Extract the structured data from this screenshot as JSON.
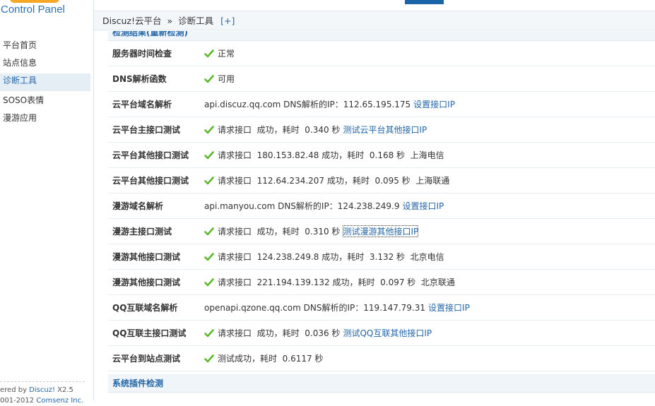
{
  "brand": {
    "name": "Control Panel",
    "accent": "#2a72b5",
    "orange": "#f39800"
  },
  "sidebar": {
    "items": [
      {
        "label": "平台首页",
        "active": false
      },
      {
        "label": "站点信息",
        "active": false
      },
      {
        "label": "诊断工具",
        "active": true
      },
      {
        "label": "SOSO表情",
        "active": false
      },
      {
        "label": "漫游应用",
        "active": false
      }
    ],
    "footer": {
      "line1_prefix": "ered by ",
      "line1_link": "Discuz!",
      "line1_suffix": " X2.5",
      "line2_prefix": "001-2012 ",
      "line2_link": "Comsenz Inc."
    }
  },
  "breadcrumb": {
    "root": "Discuz!云平台",
    "sep": "»",
    "current": "诊断工具",
    "add": "[+]"
  },
  "section_top": "检测结果(重新检测)",
  "rows": [
    {
      "label": "服务器时间检查",
      "ok": true,
      "text": "正常",
      "link": ""
    },
    {
      "label": "DNS解析函数",
      "ok": true,
      "text": "可用",
      "link": ""
    },
    {
      "label": "云平台域名解析",
      "ok": false,
      "text": "api.discuz.qq.com DNS解析的IP：112.65.195.175",
      "link": "设置接口IP"
    },
    {
      "label": "云平台主接口测试",
      "ok": true,
      "text": "请求接口  成功，耗时  0.340 秒",
      "link": "测试云平台其他接口IP"
    },
    {
      "label": "云平台其他接口测试",
      "ok": true,
      "text": "请求接口  180.153.82.48 成功，耗时  0.168 秒  上海电信",
      "link": ""
    },
    {
      "label": "云平台其他接口测试",
      "ok": true,
      "text": "请求接口  112.64.234.207 成功，耗时  0.095 秒  上海联通",
      "link": ""
    },
    {
      "label": "漫游域名解析",
      "ok": false,
      "text": "api.manyou.com DNS解析的IP：124.238.249.9",
      "link": "设置接口IP"
    },
    {
      "label": "漫游主接口测试",
      "ok": true,
      "text": "请求接口  成功，耗时  0.310 秒",
      "link": "测试漫游其他接口IP",
      "focused": true
    },
    {
      "label": "漫游其他接口测试",
      "ok": true,
      "text": "请求接口  124.238.249.8 成功，耗时  3.132 秒  北京电信",
      "link": ""
    },
    {
      "label": "漫游其他接口测试",
      "ok": true,
      "text": "请求接口  221.194.139.132 成功，耗时  0.097 秒  北京联通",
      "link": ""
    },
    {
      "label": "QQ互联域名解析",
      "ok": false,
      "text": "openapi.qzone.qq.com DNS解析的IP：119.147.79.31",
      "link": "设置接口IP"
    },
    {
      "label": "QQ互联主接口测试",
      "ok": true,
      "text": "请求接口  成功，耗时  0.036 秒",
      "link": "测试QQ互联其他接口IP"
    },
    {
      "label": "云平台到站点测试",
      "ok": true,
      "text": "测试成功，耗时  0.6117 秒",
      "link": ""
    }
  ],
  "section_bottom": "系统插件检测",
  "icons": {
    "check": "check-icon"
  },
  "colors": {
    "link": "#2366a8",
    "check": "#5cb82a",
    "active_bg": "#e6eef5"
  }
}
